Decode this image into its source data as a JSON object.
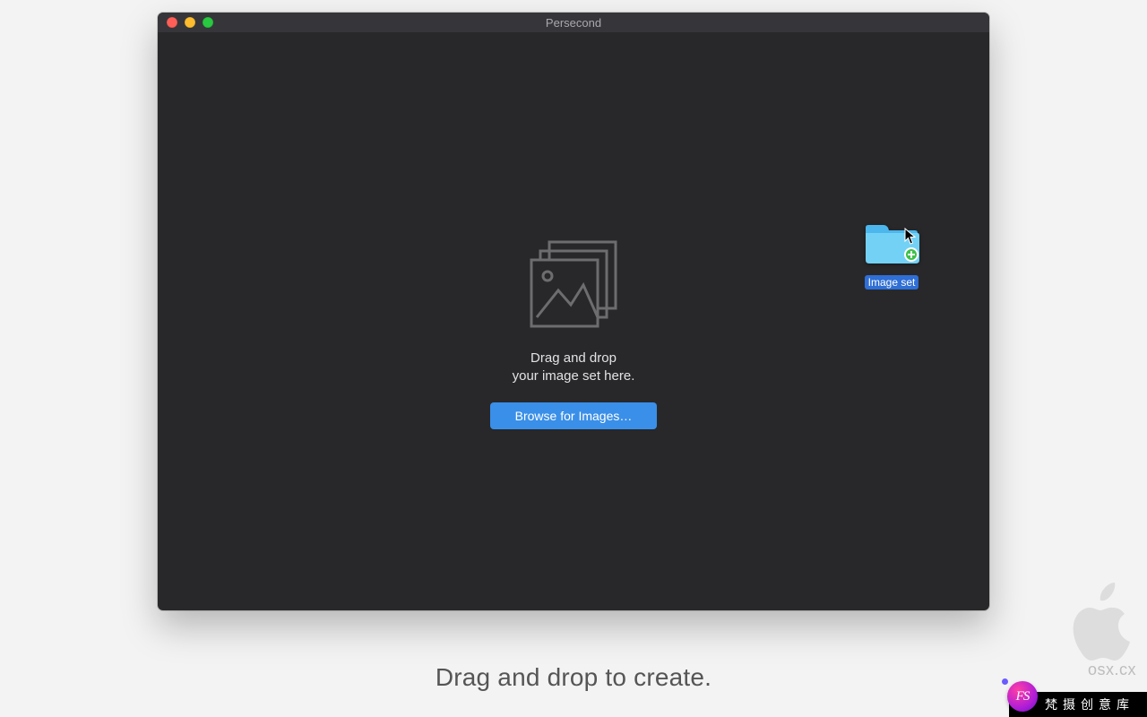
{
  "window": {
    "title": "Persecond"
  },
  "dropzone": {
    "line1": "Drag and drop",
    "line2": "your image set here.",
    "browse_label": "Browse for Images…"
  },
  "drag_item": {
    "label": "Image set"
  },
  "caption": "Drag and drop to create.",
  "watermark": {
    "site": "osx.cx",
    "badge_initials": "FS",
    "badge_text": "梵摄创意库"
  }
}
